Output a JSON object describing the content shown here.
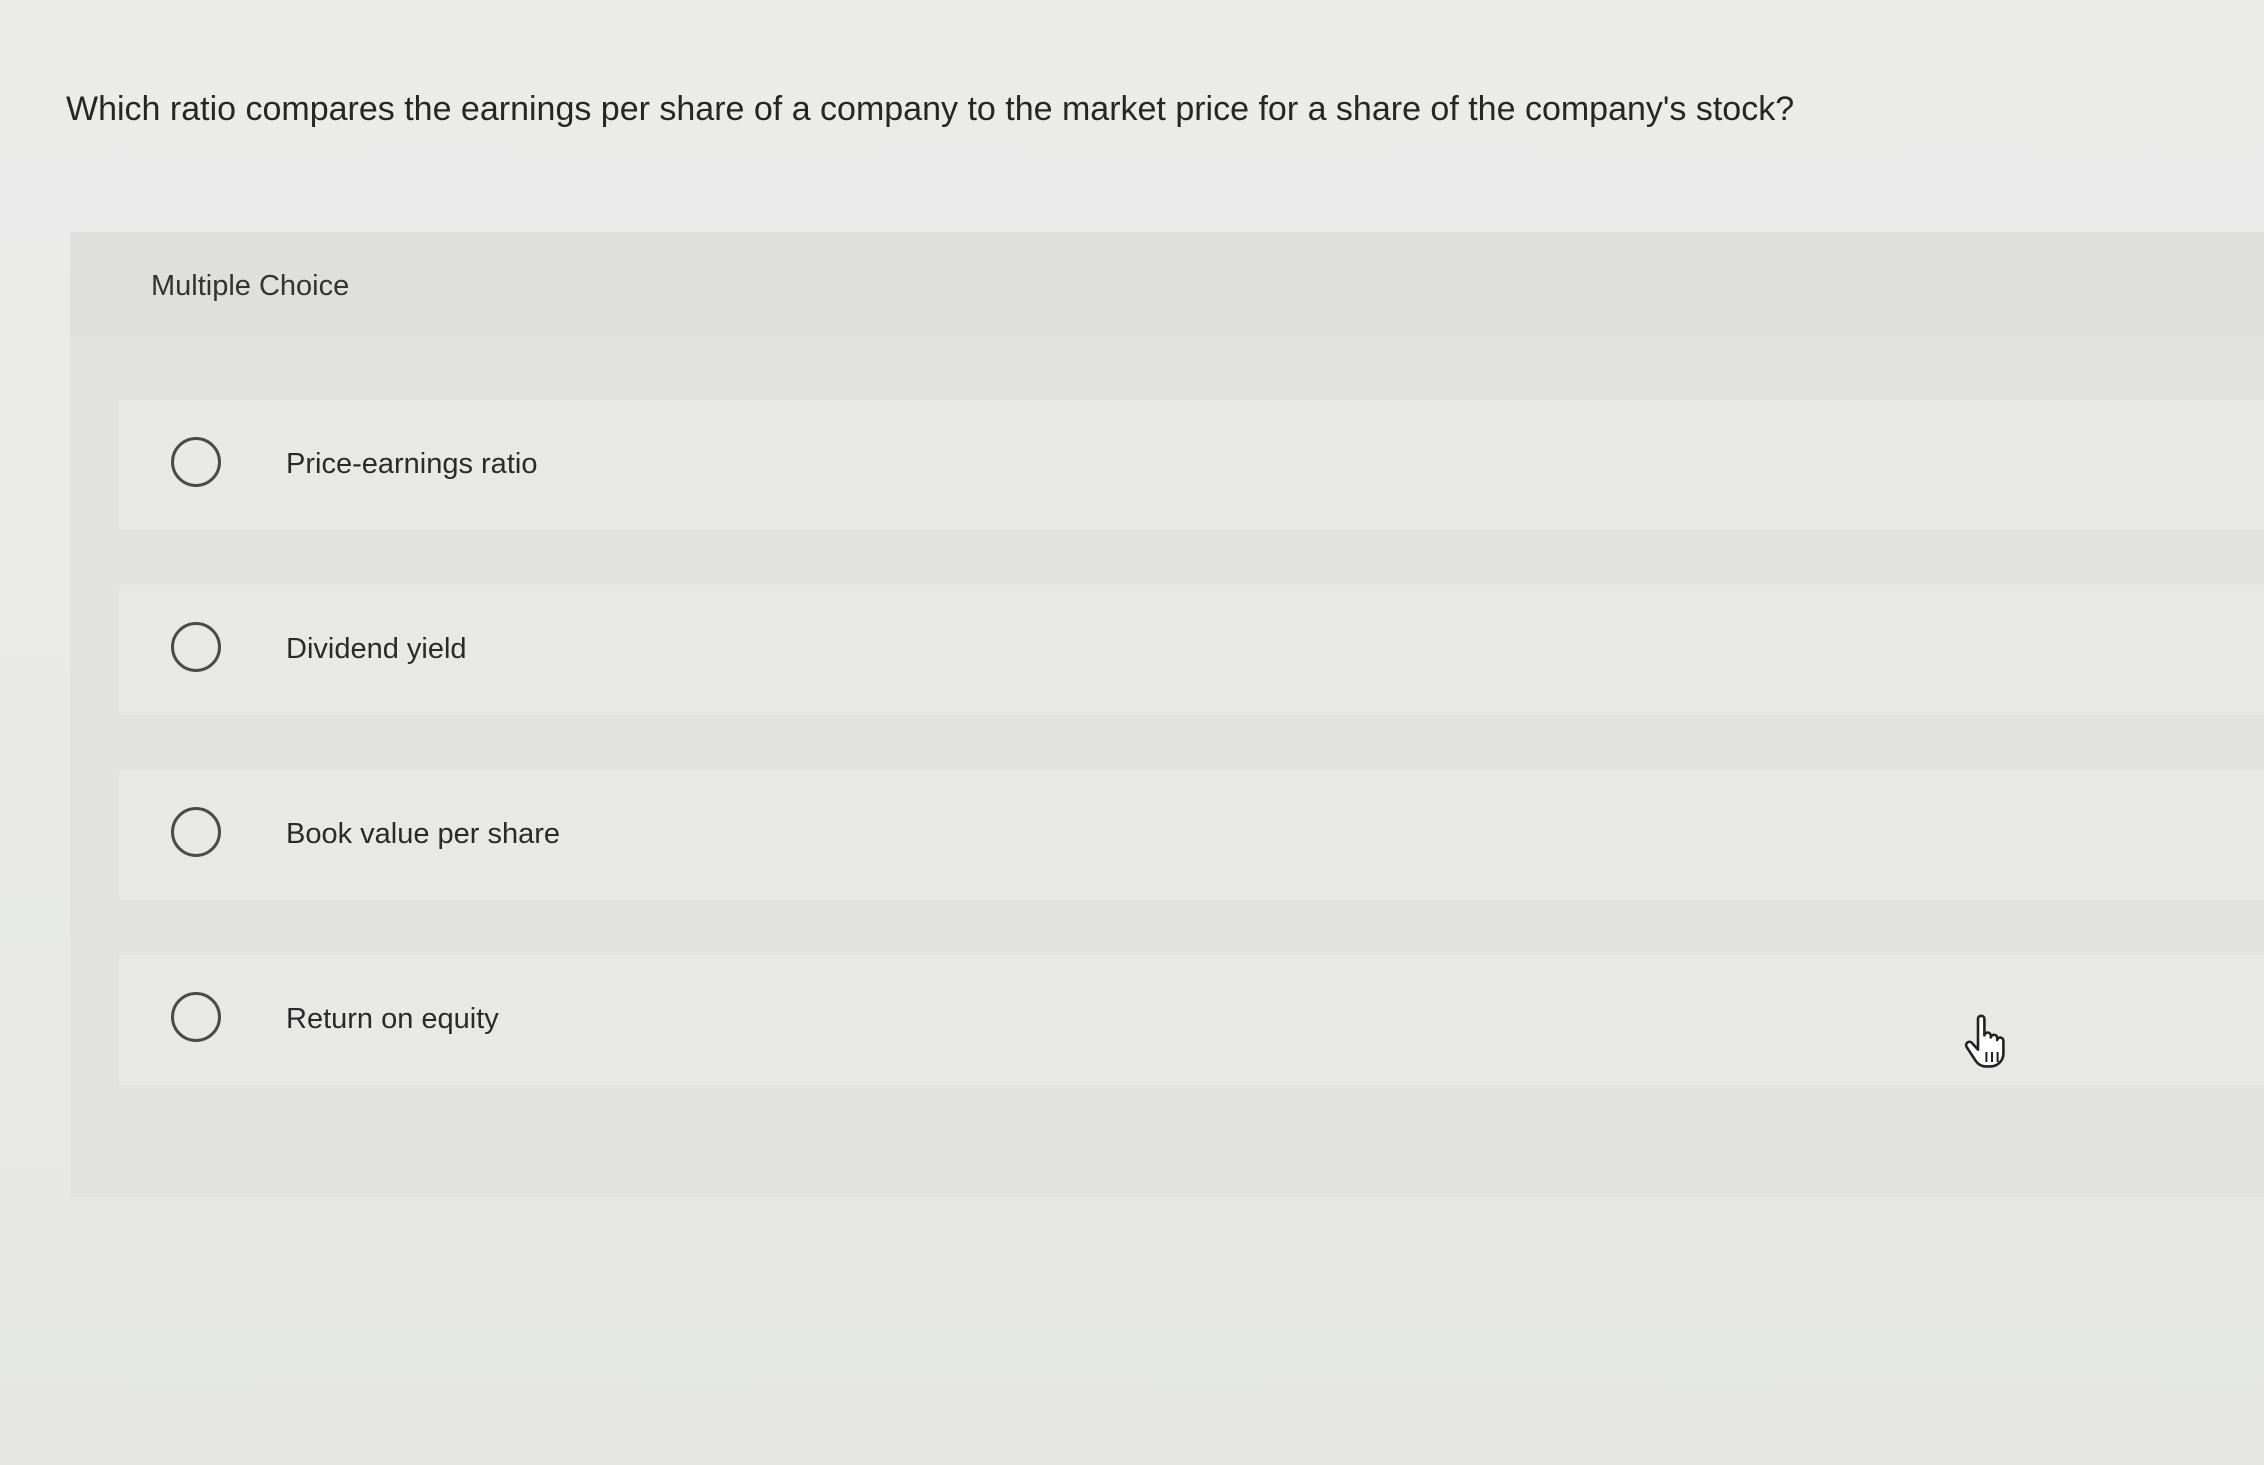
{
  "question": {
    "text": "Which ratio compares the earnings per share of a company to the market price for a share of the company's stock?"
  },
  "panel": {
    "label": "Multiple Choice"
  },
  "options": [
    {
      "label": "Price-earnings ratio",
      "selected": false
    },
    {
      "label": "Dividend yield",
      "selected": false
    },
    {
      "label": "Book value per share",
      "selected": false
    },
    {
      "label": "Return on equity",
      "selected": false
    }
  ],
  "cursor": {
    "icon": "hand-pointer-icon"
  }
}
